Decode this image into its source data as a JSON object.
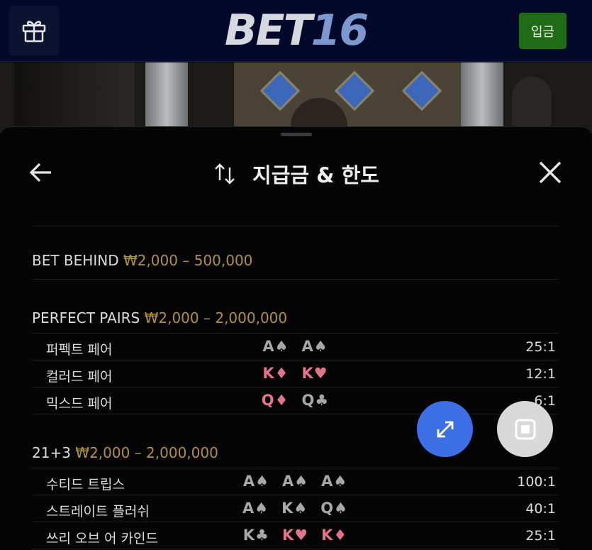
{
  "header": {
    "logo_part1": "BET",
    "logo_part2": "16",
    "deposit_label": "입금",
    "gift_icon": "gift-icon"
  },
  "sheet": {
    "title": "지급금 & 한도",
    "back_icon": "arrow-left-icon",
    "sort_icon": "swap-vertical-icon",
    "close_icon": "close-icon"
  },
  "sections": [
    {
      "name": "BET BEHIND",
      "range": "₩2,000 – 500,000",
      "rows": []
    },
    {
      "name": "PERFECT PAIRS",
      "range": "₩2,000 – 2,000,000",
      "rows": [
        {
          "label": "퍼펙트 페어",
          "cards": [
            {
              "text": "A♠",
              "color": "grey"
            },
            {
              "text": "A♠",
              "color": "grey"
            }
          ],
          "payout": "25:1"
        },
        {
          "label": "컬러드 페어",
          "cards": [
            {
              "text": "K♦",
              "color": "red"
            },
            {
              "text": "K♥",
              "color": "red"
            }
          ],
          "payout": "12:1"
        },
        {
          "label": "믹스드 페어",
          "cards": [
            {
              "text": "Q♦",
              "color": "red"
            },
            {
              "text": "Q♣",
              "color": "grey"
            }
          ],
          "payout": "6:1"
        }
      ]
    },
    {
      "name": "21+3",
      "range": "₩2,000 – 2,000,000",
      "rows": [
        {
          "label": "수티드 트립스",
          "cards": [
            {
              "text": "A♠",
              "color": "grey"
            },
            {
              "text": "A♠",
              "color": "grey"
            },
            {
              "text": "A♠",
              "color": "grey"
            }
          ],
          "payout": "100:1"
        },
        {
          "label": "스트레이트 플러쉬",
          "cards": [
            {
              "text": "A♠",
              "color": "grey"
            },
            {
              "text": "K♠",
              "color": "grey"
            },
            {
              "text": "Q♠",
              "color": "grey"
            }
          ],
          "payout": "40:1"
        },
        {
          "label": "쓰리 오브 어 카인드",
          "cards": [
            {
              "text": "K♣",
              "color": "grey"
            },
            {
              "text": "K♥",
              "color": "red"
            },
            {
              "text": "K♦",
              "color": "red"
            }
          ],
          "payout": "25:1"
        }
      ]
    }
  ],
  "fabs": {
    "expand_icon": "expand-icon",
    "stop_icon": "stop-icon"
  },
  "colors": {
    "range_gold": "#b0913e",
    "card_red": "#e3758a",
    "card_grey": "#a8a8a8",
    "deposit_green": "#1f6b17",
    "expand_blue": "#3d6fe6"
  }
}
